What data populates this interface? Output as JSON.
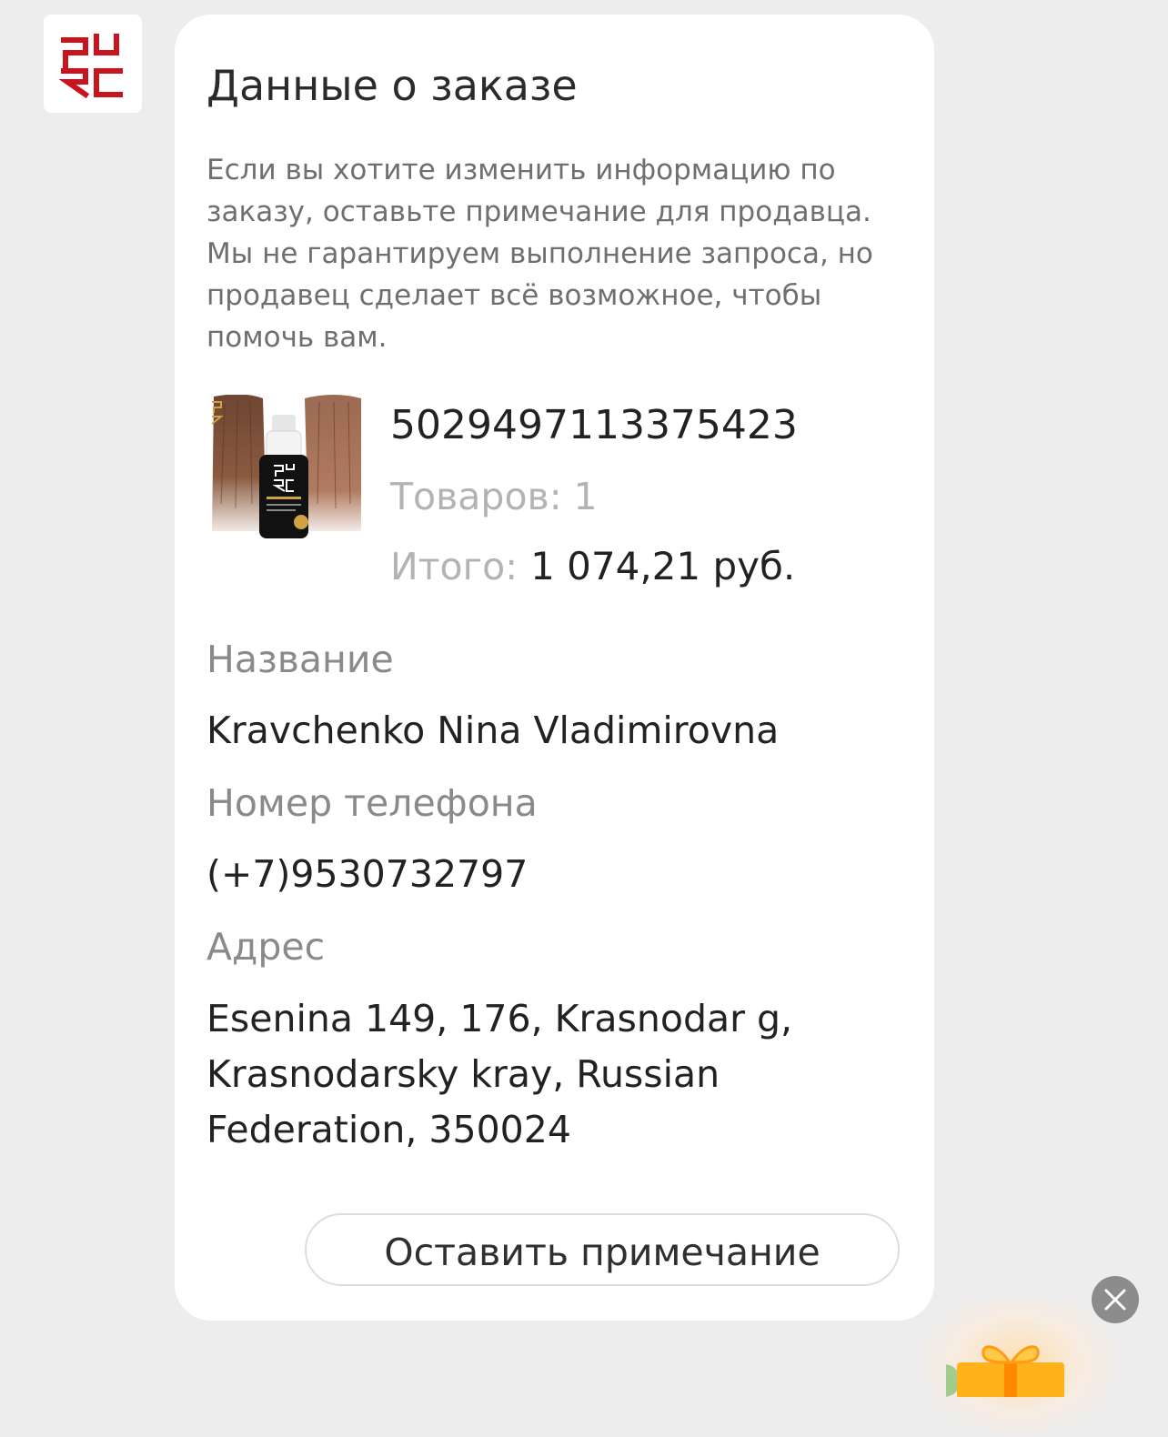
{
  "seller": {
    "logo_icon": "purc-logo-icon",
    "logo_text": "PURC",
    "brand_color": "#c8141d"
  },
  "order_card": {
    "title": "Данные о заказе",
    "description": "Если вы хотите изменить информацию по заказу, оставьте примечание для продавца. Мы не гарантируем выполнение запроса, но продавец сделает всё возможное, чтобы помочь вам.",
    "product_image_icon": "hair-serum-product-image",
    "order_number": "5029497113375423",
    "items_count_text": "Товаров: 1",
    "total_label": "Итого:",
    "total_value": "1 074,21 руб.",
    "name_label": "Название",
    "name_value": "Kravchenko Nina Vladimirovna",
    "phone_label": "Номер телефона",
    "phone_value": "(+7)9530732797",
    "address_label": "Адрес",
    "address_value": "Esenina 149, 176, Krasnodar g, Krasnodarsky kray, Russian Federation, 350024",
    "note_button_label": "Оставить примечание"
  },
  "floating": {
    "close_icon": "close-icon",
    "gift_icon": "gift-icon"
  }
}
